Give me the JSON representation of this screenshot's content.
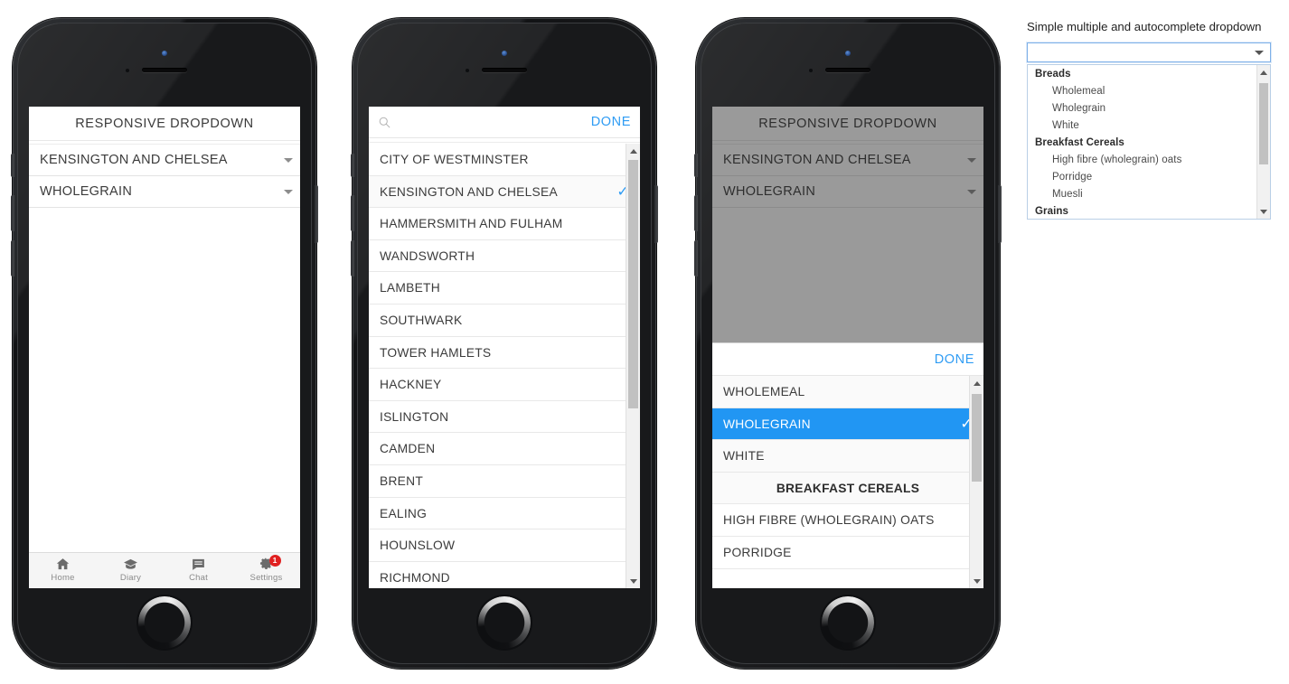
{
  "phone1": {
    "app_title": "RESPONSIVE DROPDOWN",
    "fields": [
      {
        "value": "KENSINGTON AND CHELSEA",
        "icon": "chevron-down-icon"
      },
      {
        "value": "WHOLEGRAIN",
        "icon": "chevron-down-icon"
      }
    ],
    "tabs": [
      {
        "label": "Home",
        "icon": "home-icon",
        "badge": ""
      },
      {
        "label": "Diary",
        "icon": "graduation-cap-icon",
        "badge": ""
      },
      {
        "label": "Chat",
        "icon": "chat-bubble-icon",
        "badge": ""
      },
      {
        "label": "Settings",
        "icon": "gear-icon",
        "badge": "1"
      }
    ]
  },
  "phone2": {
    "search_icon": "search-icon",
    "search_value": "",
    "search_placeholder": "",
    "done_label": "DONE",
    "items": [
      {
        "label": "CITY OF WESTMINSTER",
        "selected": false
      },
      {
        "label": "KENSINGTON AND CHELSEA",
        "selected": true
      },
      {
        "label": "HAMMERSMITH AND FULHAM",
        "selected": false
      },
      {
        "label": "WANDSWORTH",
        "selected": false
      },
      {
        "label": "LAMBETH",
        "selected": false
      },
      {
        "label": "SOUTHWARK",
        "selected": false
      },
      {
        "label": "TOWER HAMLETS",
        "selected": false
      },
      {
        "label": "HACKNEY",
        "selected": false
      },
      {
        "label": "ISLINGTON",
        "selected": false
      },
      {
        "label": "CAMDEN",
        "selected": false
      },
      {
        "label": "BRENT",
        "selected": false
      },
      {
        "label": "EALING",
        "selected": false
      },
      {
        "label": "HOUNSLOW",
        "selected": false
      },
      {
        "label": "RICHMOND",
        "selected": false
      }
    ],
    "check_glyph": "✓"
  },
  "phone3": {
    "app_title": "RESPONSIVE DROPDOWN",
    "fields": [
      {
        "value": "KENSINGTON AND CHELSEA",
        "icon": "chevron-down-icon"
      },
      {
        "value": "WHOLEGRAIN",
        "icon": "chevron-down-icon"
      }
    ],
    "done_label": "DONE",
    "items": [
      {
        "label": "WHOLEMEAL",
        "selected": false,
        "group": false
      },
      {
        "label": "WHOLEGRAIN",
        "selected": true,
        "group": false
      },
      {
        "label": "WHITE",
        "selected": false,
        "group": false
      },
      {
        "label": "BREAKFAST CEREALS",
        "selected": false,
        "group": true
      },
      {
        "label": "HIGH FIBRE (WHOLEGRAIN) OATS",
        "selected": false,
        "group": false
      },
      {
        "label": "PORRIDGE",
        "selected": false,
        "group": false
      }
    ],
    "check_glyph": "✓"
  },
  "panel": {
    "label": "Simple multiple and autocomplete dropdown",
    "select_value": "",
    "caret_icon": "chevron-down-icon",
    "options": [
      {
        "label": "Breads",
        "group": true
      },
      {
        "label": "Wholemeal",
        "group": false
      },
      {
        "label": "Wholegrain",
        "group": false
      },
      {
        "label": "White",
        "group": false
      },
      {
        "label": "Breakfast Cereals",
        "group": true
      },
      {
        "label": "High fibre (wholegrain) oats",
        "group": false
      },
      {
        "label": "Porridge",
        "group": false
      },
      {
        "label": "Muesli",
        "group": false
      },
      {
        "label": "Grains",
        "group": true
      }
    ]
  },
  "colors": {
    "accent_blue": "#2f9cf4",
    "selection_blue": "#2196f3",
    "badge_red": "#e02020",
    "frame_dark": "#18191b"
  }
}
